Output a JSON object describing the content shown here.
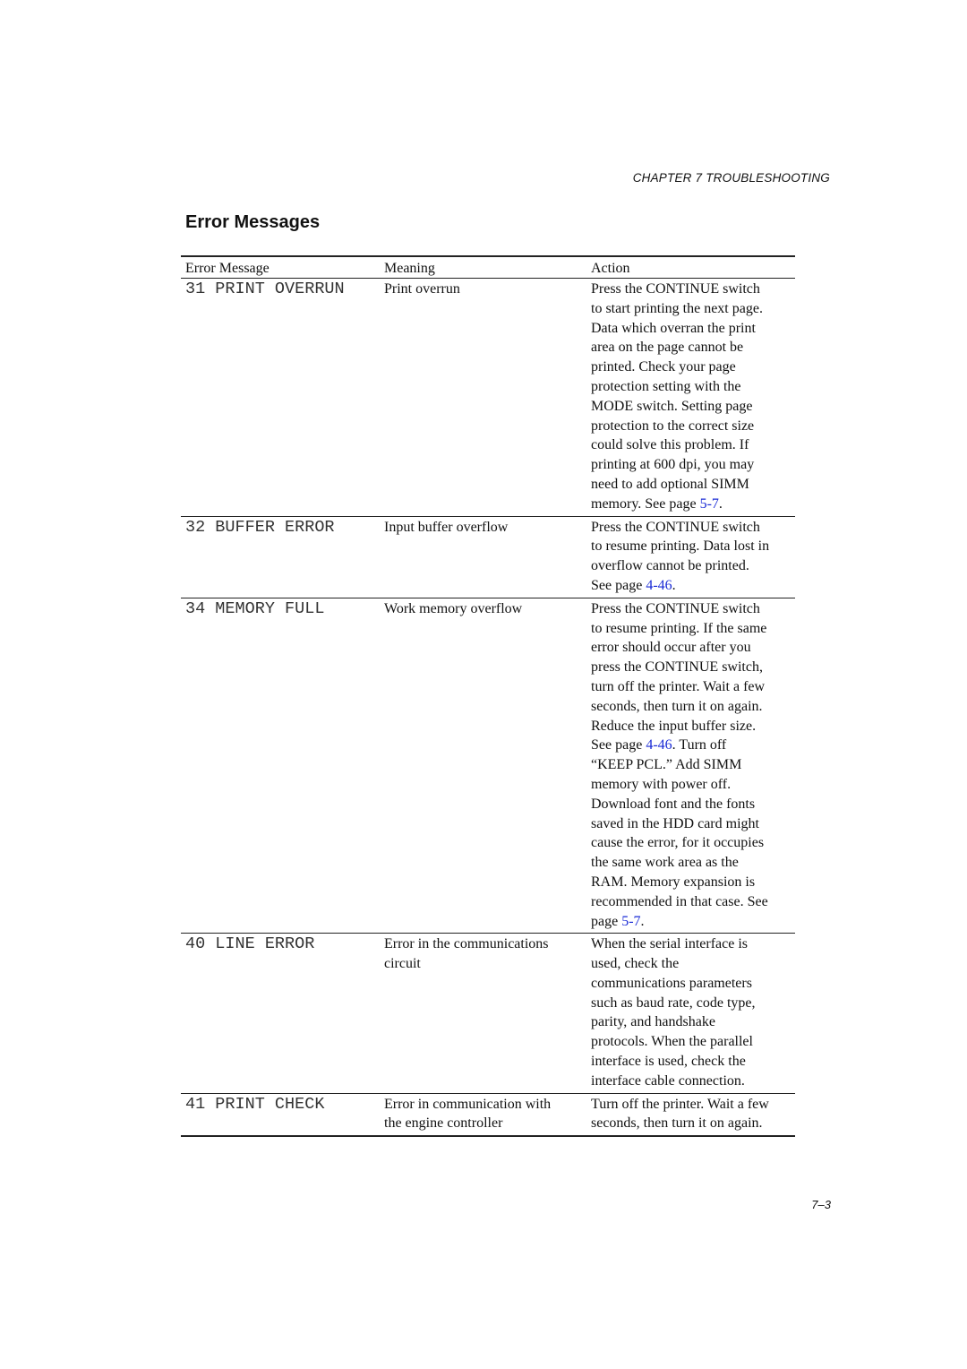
{
  "header": {
    "chapter": "CHAPTER 7 TROUBLESHOOTING"
  },
  "section": {
    "title": "Error Messages"
  },
  "table": {
    "columns": [
      "Error Message",
      "Meaning",
      "Action"
    ],
    "rows": [
      {
        "code": "31 PRINT OVERRUN",
        "meaning": [
          "Print overrun"
        ],
        "action": [
          {
            "text": "Press the CONTINUE switch"
          },
          {
            "text": "to start printing the next page."
          },
          {
            "text": "Data which overran the print"
          },
          {
            "text": "area on the page cannot be"
          },
          {
            "text": "printed. Check your page"
          },
          {
            "text": "protection setting with the"
          },
          {
            "text": "MODE switch. Setting page"
          },
          {
            "text": "protection to the correct size"
          },
          {
            "text": "could solve this problem. If"
          },
          {
            "text": "printing at 600 dpi, you may"
          },
          {
            "text": "need to add optional SIMM"
          },
          {
            "text": "memory. See page ",
            "link": "5-7",
            "after": "."
          }
        ]
      },
      {
        "code": "32 BUFFER ERROR",
        "meaning": [
          "Input buffer overflow"
        ],
        "action": [
          {
            "text": "Press the CONTINUE switch"
          },
          {
            "text": "to resume printing. Data lost in"
          },
          {
            "text": "overflow cannot be printed."
          },
          {
            "text": "See page ",
            "link": "4-46",
            "after": "."
          }
        ]
      },
      {
        "code": "34 MEMORY FULL",
        "meaning": [
          "Work memory overflow"
        ],
        "action": [
          {
            "text": "Press the CONTINUE switch"
          },
          {
            "text": "to resume printing. If the same"
          },
          {
            "text": "error should occur after you"
          },
          {
            "text": "press the CONTINUE switch,"
          },
          {
            "text": "turn off the printer. Wait a few"
          },
          {
            "text": "seconds, then turn it on again."
          },
          {
            "text": "Reduce the input buffer size."
          },
          {
            "text": "See page ",
            "link": "4-46",
            "after": ". Turn off"
          },
          {
            "text": "“KEEP PCL.” Add SIMM"
          },
          {
            "text": "memory with power off."
          },
          {
            "text": "Download font and the fonts"
          },
          {
            "text": "saved in the HDD card might"
          },
          {
            "text": "cause the error, for it occupies"
          },
          {
            "text": "the same work area as the"
          },
          {
            "text": "RAM. Memory expansion is"
          },
          {
            "text": "recommended in that case. See"
          },
          {
            "text": "page ",
            "link": "5-7",
            "after": "."
          }
        ]
      },
      {
        "code": "40 LINE ERROR",
        "meaning": [
          "Error in the communications",
          "circuit"
        ],
        "action": [
          {
            "text": "When the serial interface is"
          },
          {
            "text": "used, check the"
          },
          {
            "text": "communications parameters"
          },
          {
            "text": "such as baud rate, code type,"
          },
          {
            "text": "parity, and handshake"
          },
          {
            "text": "protocols. When the parallel"
          },
          {
            "text": "interface is used, check the"
          },
          {
            "text": "interface cable connection."
          }
        ]
      },
      {
        "code": "41 PRINT CHECK",
        "meaning": [
          "Error in communication with",
          "the engine controller"
        ],
        "action": [
          {
            "text": "Turn off the printer. Wait a few"
          },
          {
            "text": "seconds, then turn it on again."
          }
        ]
      }
    ]
  },
  "footer": {
    "page_number": "7–3"
  },
  "colors": {
    "link": "#1a2bd6",
    "text": "#111111",
    "rule": "#222222"
  }
}
